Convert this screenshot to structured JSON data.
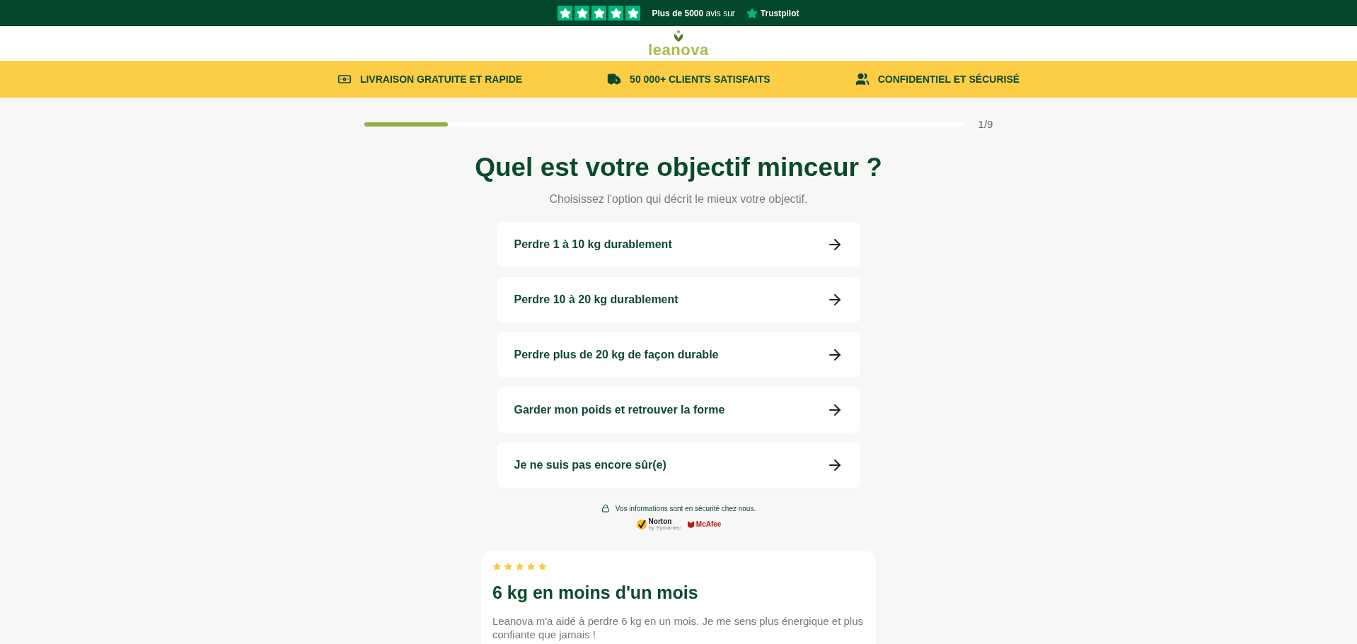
{
  "trust_bar": {
    "stars": 5,
    "count": "Plus de 5000",
    "suffix": "avis sur",
    "brand": "Trustpilot"
  },
  "logo": {
    "text": "leanova"
  },
  "benefits": [
    {
      "kind": "cash",
      "label": "LIVRAISON GRATUITE ET RAPIDE"
    },
    {
      "kind": "truck",
      "label": "50 000+ CLIENTS SATISFAITS"
    },
    {
      "kind": "people",
      "label": "CONFIDENTIEL ET SÉCURISÉ"
    }
  ],
  "progress": {
    "level": 0.14,
    "step": "1/9"
  },
  "question": {
    "title": "Quel est votre objectif minceur ?",
    "subtitle": "Choisissez l'option qui décrit le mieux votre objectif."
  },
  "options": [
    {
      "label": "Perdre 1 à 10 kg durablement"
    },
    {
      "label": "Perdre 10 à 20 kg durablement"
    },
    {
      "label": "Perdre plus de 20 kg de façon durable"
    },
    {
      "label": "Garder mon poids et retrouver la forme"
    },
    {
      "label": "Je ne suis pas encore sûr(e)"
    }
  ],
  "security": {
    "text": "Vos informations sont en sécurité chez nous.",
    "norton": "Norton",
    "norton_sub": "by Symantec",
    "mcafee": "McAfee"
  },
  "review": {
    "stars": 5,
    "title": "6 kg en moins d'un mois",
    "text": "Leanova m'a aidé à perdre 6 kg en un mois. Je me sens plus énergique et plus confiante que jamais !"
  }
}
